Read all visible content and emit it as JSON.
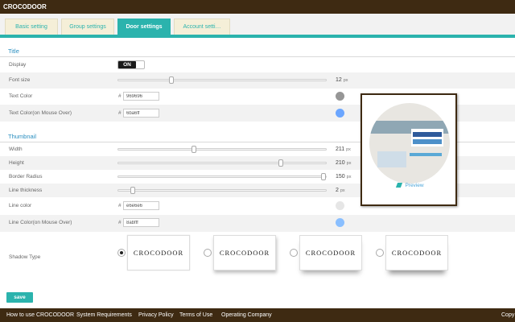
{
  "app": {
    "title": "CROCODOOR"
  },
  "tabs": [
    {
      "label": "Basic setting"
    },
    {
      "label": "Group settings"
    },
    {
      "label": "Door settings"
    },
    {
      "label": "Account setti…"
    }
  ],
  "title_section": {
    "heading": "Title",
    "display": {
      "label": "Display",
      "toggle": "ON"
    },
    "font_size": {
      "label": "Font size",
      "value": "12",
      "unit": "px",
      "position": 0.25
    },
    "text_color": {
      "label": "Text Color",
      "hash": "#",
      "value": "969696",
      "color": "#969696"
    },
    "text_color_hover": {
      "label": "Text Color(on Mouse Over)",
      "hash": "#",
      "value": "6ba6ff",
      "color": "#6ba6ff"
    }
  },
  "thumbnail_section": {
    "heading": "Thumbnail",
    "width": {
      "label": "Width",
      "value": "211",
      "unit": "px",
      "position": 0.36
    },
    "height": {
      "label": "Height",
      "value": "210",
      "unit": "px",
      "position": 0.79
    },
    "border_radius": {
      "label": "Border Radius",
      "value": "150",
      "unit": "px",
      "position": 1.0
    },
    "line_thickness": {
      "label": "Line thickness",
      "value": "2",
      "unit": "px",
      "position": 0.06
    },
    "line_color": {
      "label": "Line color",
      "hash": "#",
      "value": "e6e6e6",
      "color": "#e6e6e6"
    },
    "line_color_hover": {
      "label": "Line Color(on Mouse Over)",
      "hash": "#",
      "value": "8abfff",
      "color": "#8abfff"
    },
    "shadow_type": {
      "label": "Shadow Type",
      "options": [
        "CROCODOOR",
        "CROCODOOR",
        "CROCODOOR",
        "CROCODOOR"
      ],
      "selected": 0
    }
  },
  "preview": {
    "label": "Preview"
  },
  "save": {
    "label": "save"
  },
  "footer": {
    "links": [
      "How to use CROCODOOR",
      "System Requirements",
      "Privacy Policy",
      "Terms of Use",
      "Operating Company"
    ],
    "right": "Copy"
  },
  "colors": {
    "brand": "#3e2a12",
    "accent": "#2bb3ad",
    "section_title": "#2b8fc0"
  }
}
